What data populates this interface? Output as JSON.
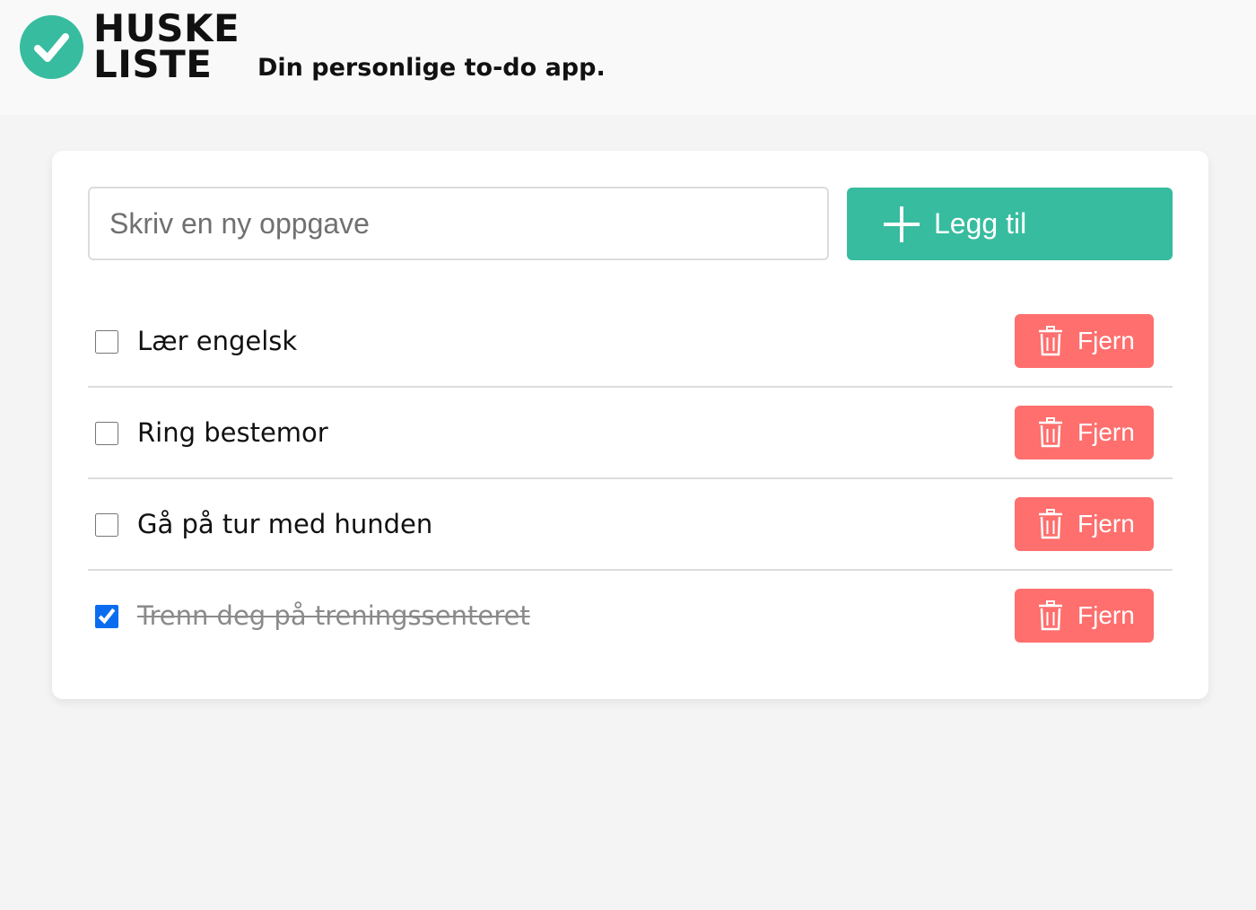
{
  "app": {
    "logo_line1": "HUSKE",
    "logo_line2": "LISTE",
    "tagline": "Din personlige to-do app.",
    "logo_icon": "check-circle-icon",
    "accent_color": "#37bc9f",
    "danger_color": "#fe6f6e"
  },
  "new_task": {
    "placeholder": "Skriv en ny oppgave",
    "value": "",
    "add_label": "Legg til",
    "add_icon": "plus-icon"
  },
  "todos": [
    {
      "text": "Lær engelsk",
      "done": false,
      "remove_label": "Fjern",
      "remove_icon": "trash-icon"
    },
    {
      "text": "Ring bestemor",
      "done": false,
      "remove_label": "Fjern",
      "remove_icon": "trash-icon"
    },
    {
      "text": "Gå på tur med hunden",
      "done": false,
      "remove_label": "Fjern",
      "remove_icon": "trash-icon"
    },
    {
      "text": "Trenn deg på treningssenteret",
      "done": true,
      "remove_label": "Fjern",
      "remove_icon": "trash-icon"
    }
  ]
}
